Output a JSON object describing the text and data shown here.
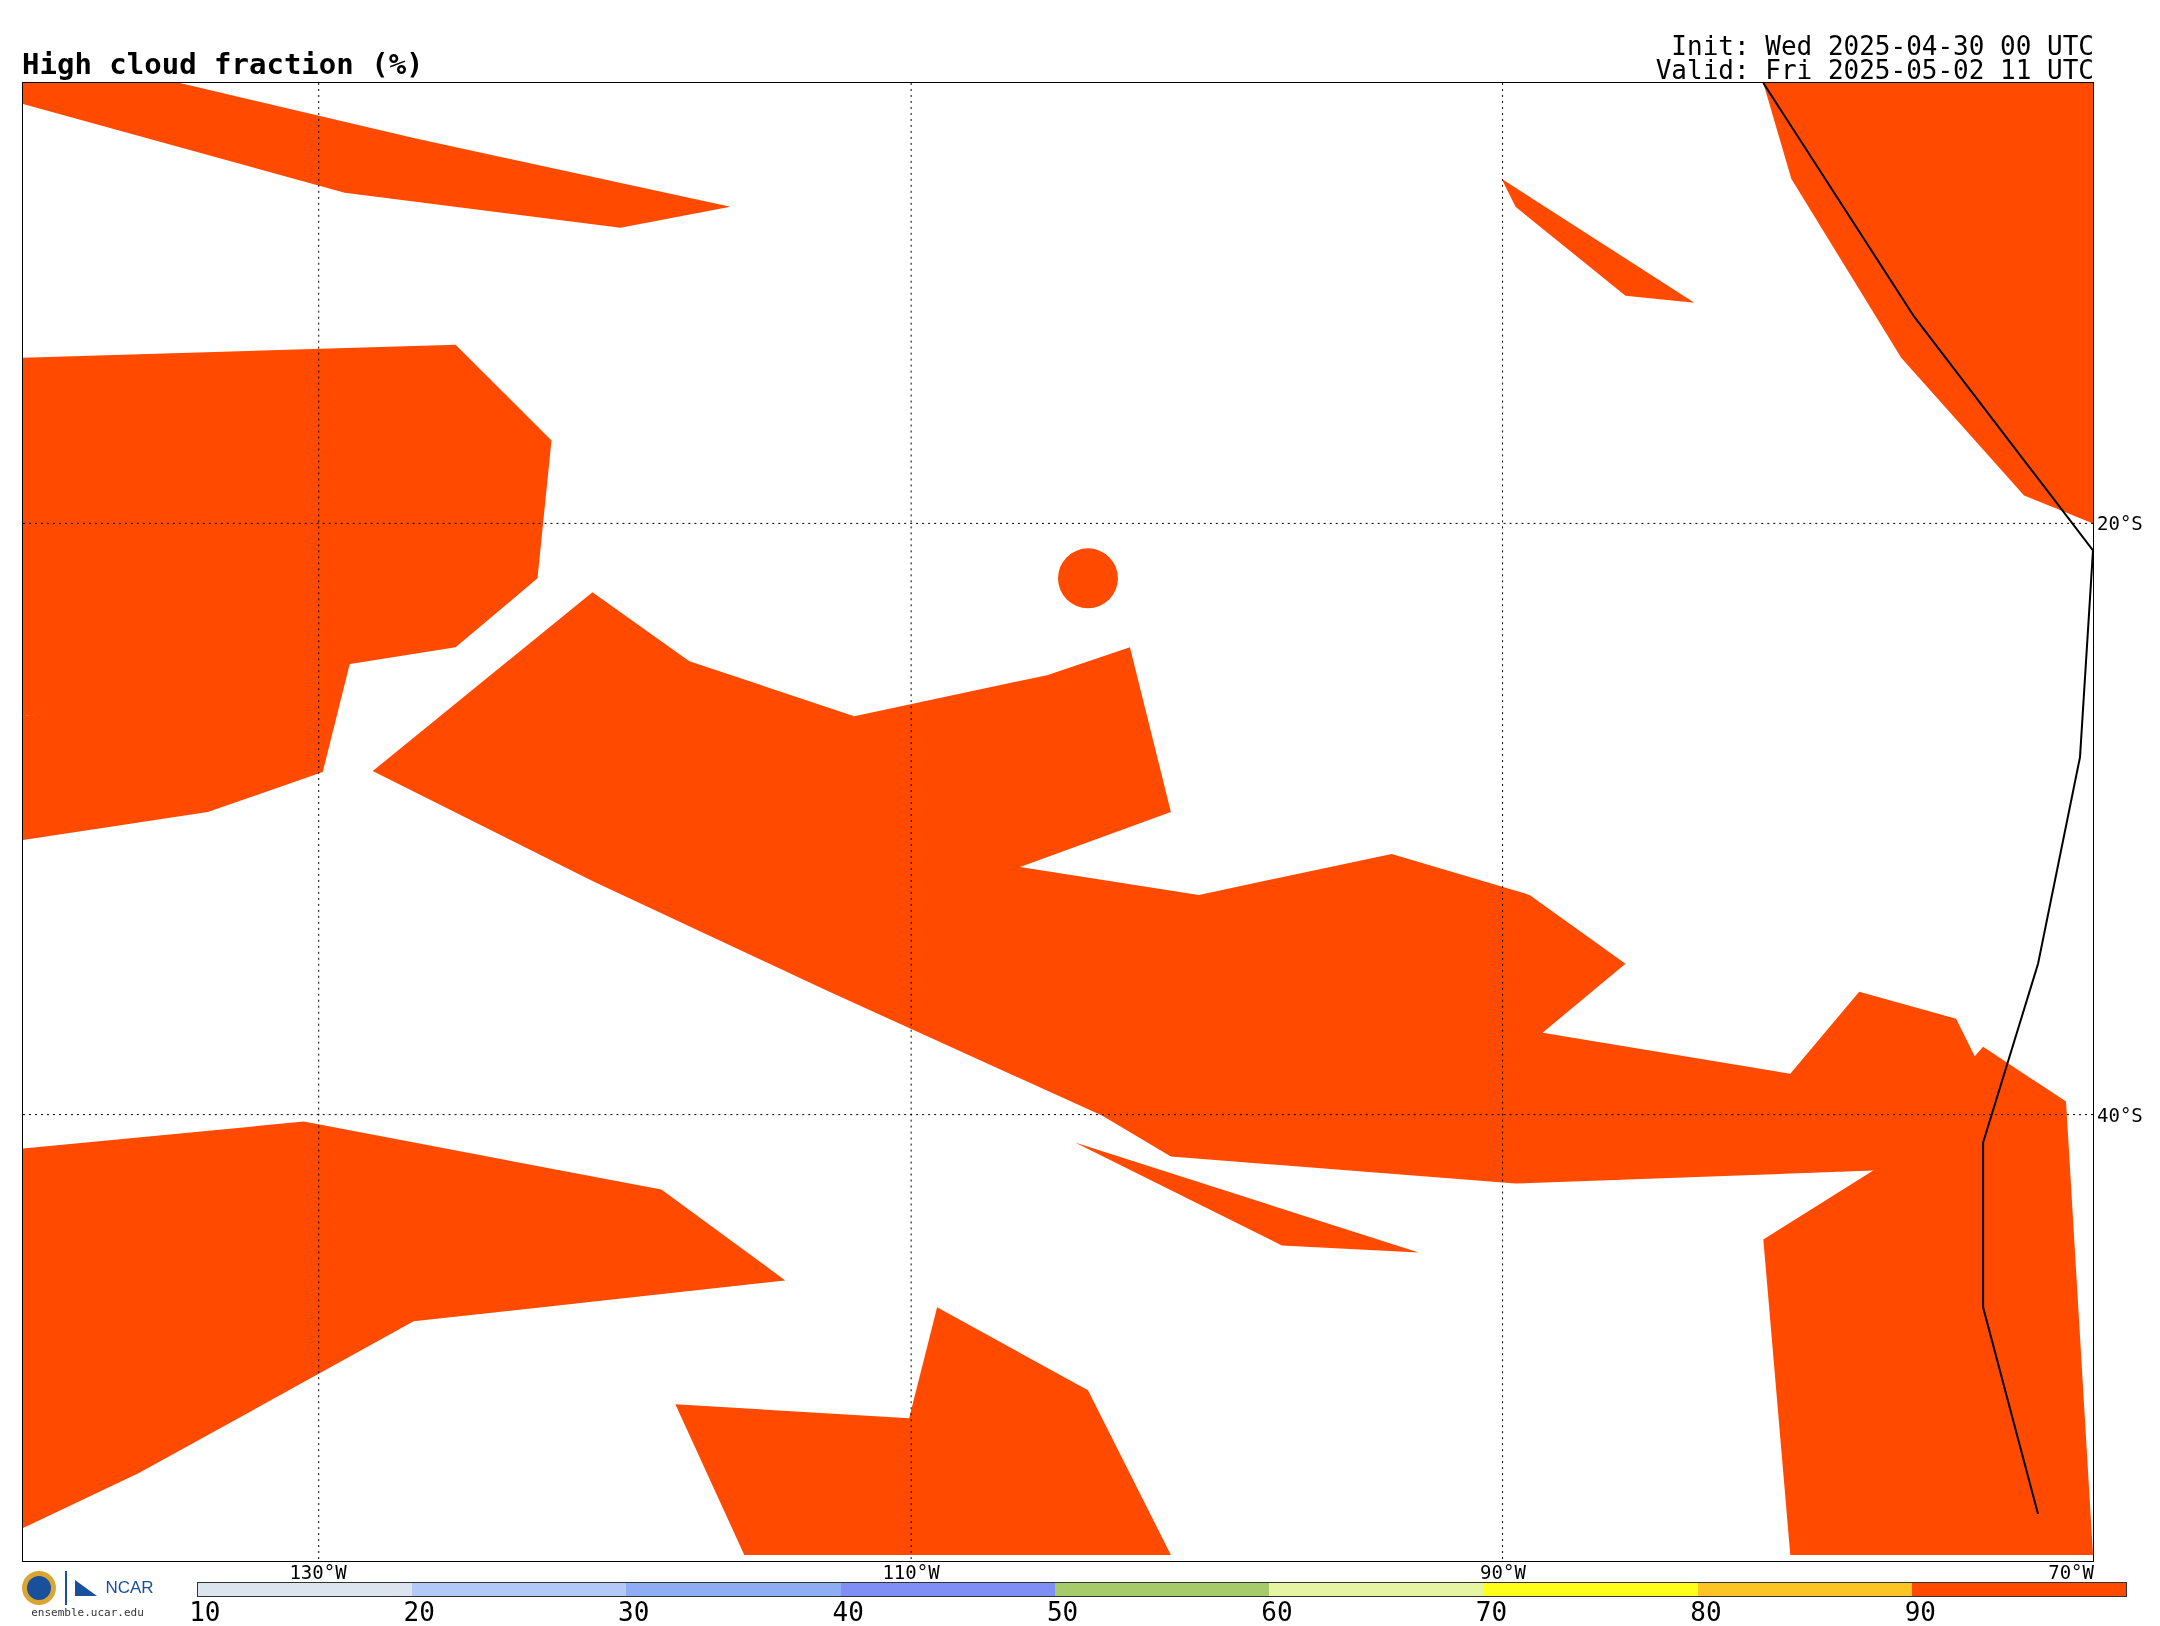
{
  "title": "High cloud fraction (%)",
  "init": "Init: Wed 2025-04-30 00 UTC",
  "valid": "Valid: Fri 2025-05-02 11 UTC",
  "map": {
    "lat_labels": [
      "20°S",
      "40°S"
    ],
    "lon_labels": [
      "130°W",
      "110°W",
      "90°W",
      "70°W"
    ]
  },
  "logo": {
    "name": "NCAR",
    "url": "ensemble.ucar.edu"
  },
  "colorbar": {
    "bins": [
      {
        "color": "#dce5ef"
      },
      {
        "color": "#b3c9f7"
      },
      {
        "color": "#8fadf5"
      },
      {
        "color": "#7f8ff5"
      },
      {
        "color": "#a6cb6a"
      },
      {
        "color": "#e5f5a3"
      },
      {
        "color": "#ffff1a"
      },
      {
        "color": "#fcc524"
      },
      {
        "color": "#ff4a00"
      }
    ],
    "ticks": [
      "10",
      "20",
      "30",
      "40",
      "50",
      "60",
      "70",
      "80",
      "90"
    ]
  }
}
